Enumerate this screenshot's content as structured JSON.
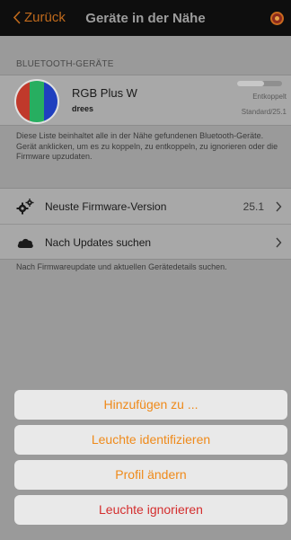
{
  "nav": {
    "back_label": "Zurück",
    "title": "Geräte in der Nähe",
    "accent_color": "#c06a1c",
    "right_icon": "light-bulb-icon"
  },
  "bluetooth_section": {
    "header": "BLUETOOTH-GERÄTE",
    "device": {
      "name": "RGB Plus W",
      "manufacturer": "drees",
      "status": "Entkoppelt",
      "firmware": "Standard/25.1",
      "signal_level": 0.6,
      "thumb_colors": [
        "#c0392b",
        "#27ae60",
        "#1f3fbf"
      ]
    },
    "description": "Diese Liste beinhaltet alle in der Nähe gefundenen Bluetooth-Geräte. Gerät anklicken, um es zu koppeln, zu entkoppeln, zu ignorieren oder die Firmware upzudaten."
  },
  "firmware_section": {
    "items": [
      {
        "icon": "gears-icon",
        "label": "Neuste Firmware-Version",
        "value": "25.1"
      },
      {
        "icon": "cloud-icon",
        "label": "Nach Updates suchen",
        "value": ""
      }
    ],
    "note": "Nach Firmwareupdate und aktuellen Gerätedetails suchen."
  },
  "action_sheet": {
    "buttons": [
      {
        "label": "Hinzufügen zu ...",
        "style": "default"
      },
      {
        "label": "Leuchte identifizieren",
        "style": "default"
      },
      {
        "label": "Profil ändern",
        "style": "default"
      },
      {
        "label": "Leuchte ignorieren",
        "style": "destructive"
      }
    ],
    "default_color": "#ef8a1a",
    "destructive_color": "#d42e2e"
  }
}
